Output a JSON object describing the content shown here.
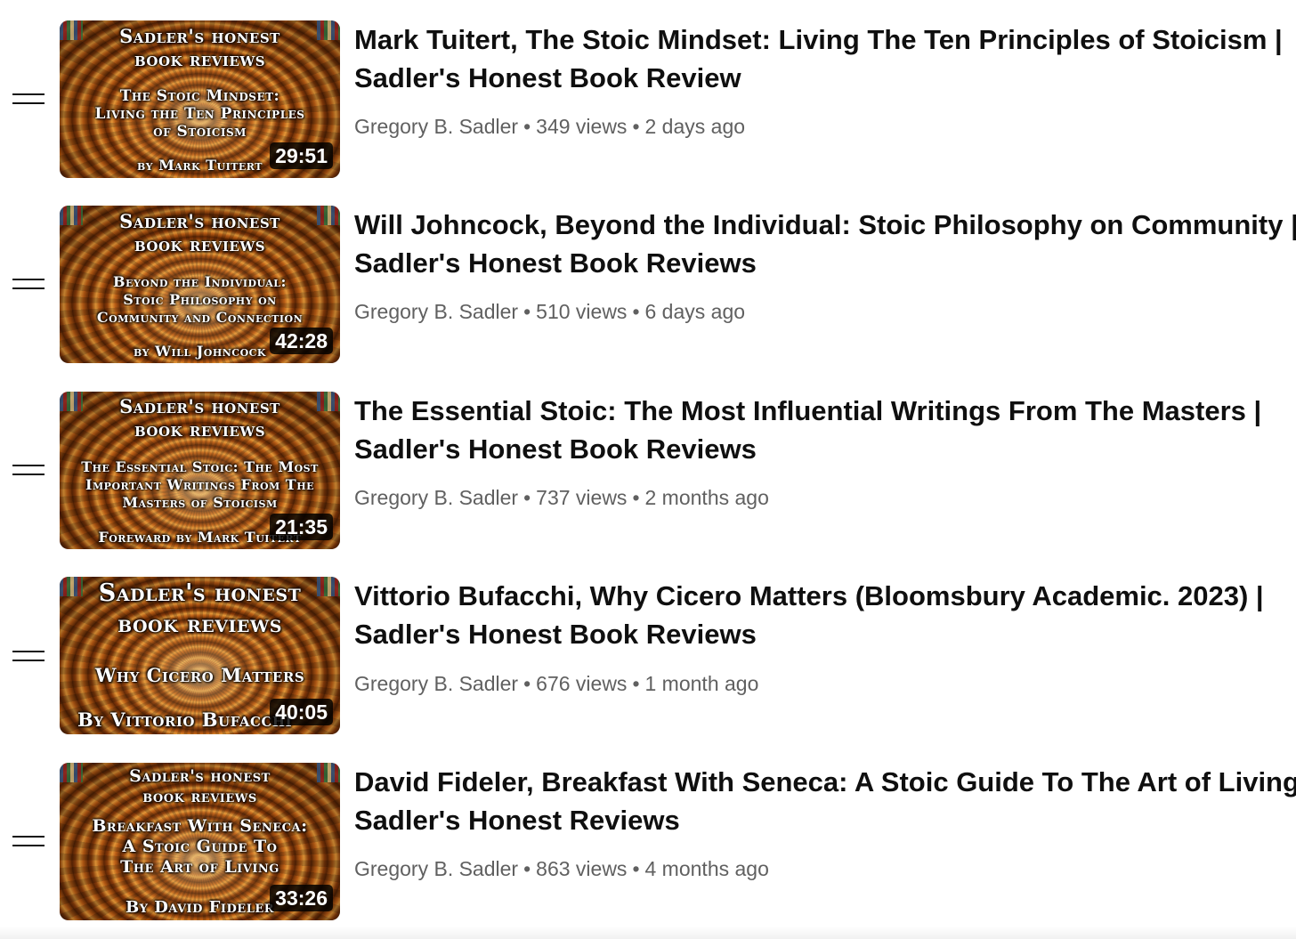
{
  "videos": [
    {
      "title_line1": "Mark Tuitert, The Stoic Mindset: Living The Ten Principles of Stoicism |",
      "title_line2": "Sadler's Honest Book Review",
      "channel": "Gregory B. Sadler",
      "views": "349 views",
      "age": "2 days ago",
      "duration": "29:51",
      "thumb": {
        "header1": "Sadler's honest",
        "header2": "book reviews",
        "line1": "The Stoic Mindset:",
        "line2": "Living the Ten Principles",
        "line3": "of Stoicism",
        "byline": "by Mark Tuitert"
      }
    },
    {
      "title_line1": "Will Johncock, Beyond the Individual: Stoic Philosophy on Community |",
      "title_line2": "Sadler's Honest Book Reviews",
      "channel": "Gregory B. Sadler",
      "views": "510 views",
      "age": "6 days ago",
      "duration": "42:28",
      "thumb": {
        "header1": "Sadler's honest",
        "header2": "book reviews",
        "line1": "Beyond the Individual:",
        "line2": "Stoic Philosophy on",
        "line3": "Community and Connection",
        "byline": "by Will Johncock"
      }
    },
    {
      "title_line1": "The Essential Stoic: The Most Influential Writings From The Masters |",
      "title_line2": "Sadler's Honest Book Reviews",
      "channel": "Gregory B. Sadler",
      "views": "737 views",
      "age": "2 months ago",
      "duration": "21:35",
      "thumb": {
        "header1": "Sadler's honest",
        "header2": "book reviews",
        "line1": "The Essential Stoic: The Most",
        "line2": "Important Writings From The",
        "line3": "Masters of Stoicism",
        "byline": "Foreward by Mark Tuitert"
      }
    },
    {
      "title_line1": "Vittorio Bufacchi, Why Cicero Matters (Bloomsbury Academic. 2023) |",
      "title_line2": "Sadler's Honest Book Reviews",
      "channel": "Gregory B. Sadler",
      "views": "676 views",
      "age": "1 month ago",
      "duration": "40:05",
      "thumb": {
        "header1": "Sadler's honest",
        "header2": "book reviews",
        "line1": "Why Cicero Matters",
        "line2": "",
        "line3": "",
        "byline": "By Vittorio Bufacchi"
      }
    },
    {
      "title_line1": "David Fideler, Breakfast With Seneca: A Stoic Guide To The Art of Living |",
      "title_line2": "Sadler's Honest Reviews",
      "channel": "Gregory B. Sadler",
      "views": "863 views",
      "age": "4 months ago",
      "duration": "33:26",
      "thumb": {
        "header1": "Sadler's honest",
        "header2": "book reviews",
        "line1": "Breakfast With Seneca:",
        "line2": "A Stoic Guide To",
        "line3": "The Art of Living",
        "byline": "By David Fideler"
      }
    }
  ],
  "separator": "•",
  "icons": {
    "drag_handle": "drag-handle-icon"
  }
}
